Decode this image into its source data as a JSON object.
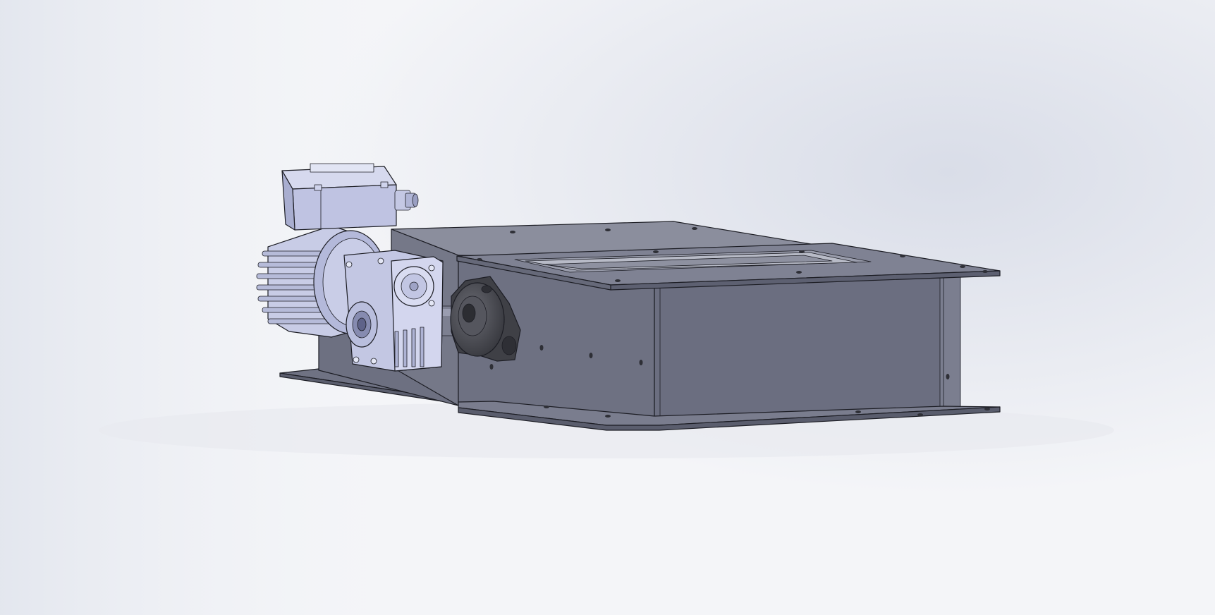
{
  "scene": {
    "background": {
      "base": "#f4f5f8",
      "tint": "#d9dde8",
      "shadow": "#c6cbd6"
    },
    "colors": {
      "housing_top": "#8a8d9c",
      "housing_side": "#6c6f80",
      "housing_front": "#737687",
      "flange": "#7c7f90",
      "flange_edge": "#5e6172",
      "motor_light": "#c9cde6",
      "motor_mid": "#aeb3d3",
      "motor_dark": "#8d92b4",
      "bearing": "#4a4b52",
      "bearing_light": "#6a6b73",
      "shaft": "#7d8091"
    },
    "parts": [
      "gate-housing",
      "top-flange",
      "bottom-flange",
      "inlet-opening",
      "mounting-base-plate",
      "gear-motor",
      "worm-gearbox",
      "motor-terminal-box",
      "cable-gland",
      "drive-shaft",
      "flange-bearing"
    ]
  }
}
